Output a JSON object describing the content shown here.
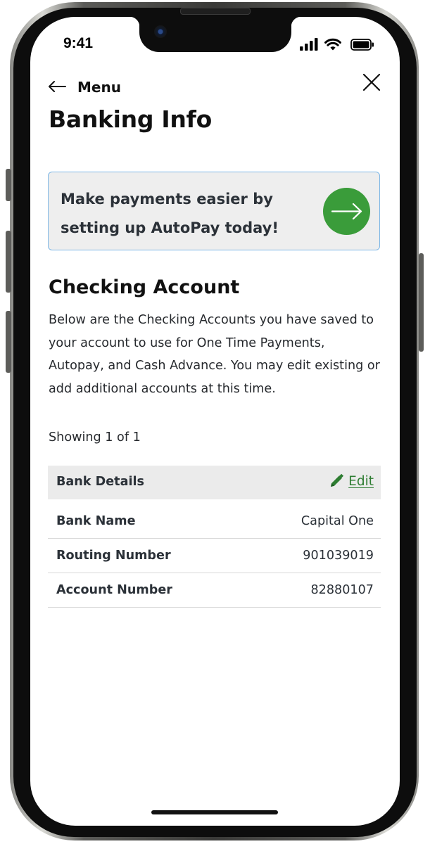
{
  "status_bar": {
    "time": "9:41"
  },
  "header": {
    "back_label": "Menu",
    "page_title": "Banking Info"
  },
  "promo": {
    "text": "Make payments easier by setting up AutoPay today!"
  },
  "checking": {
    "title": "Checking Account",
    "description": "Below are the Checking Accounts you have saved to your account to use for One Time Payments, Autopay, and Cash Advance. You may edit existing or add additional accounts at this time.",
    "showing": "Showing 1 of 1"
  },
  "bank_details": {
    "header_label": "Bank Details",
    "edit_label": "Edit",
    "rows": [
      {
        "label": "Bank Name",
        "value": "Capital One"
      },
      {
        "label": "Routing Number",
        "value": "901039019"
      },
      {
        "label": "Account Number",
        "value": "82880107"
      }
    ]
  },
  "colors": {
    "accent_green": "#3a9c3a",
    "link_green": "#2e7d32",
    "promo_border": "#7fb8e6",
    "promo_bg": "#eeeeee",
    "table_header_bg": "#ebebeb"
  },
  "icons": [
    "back-arrow-icon",
    "close-icon",
    "arrow-right-icon",
    "pencil-icon",
    "signal-icon",
    "wifi-icon",
    "battery-icon"
  ]
}
